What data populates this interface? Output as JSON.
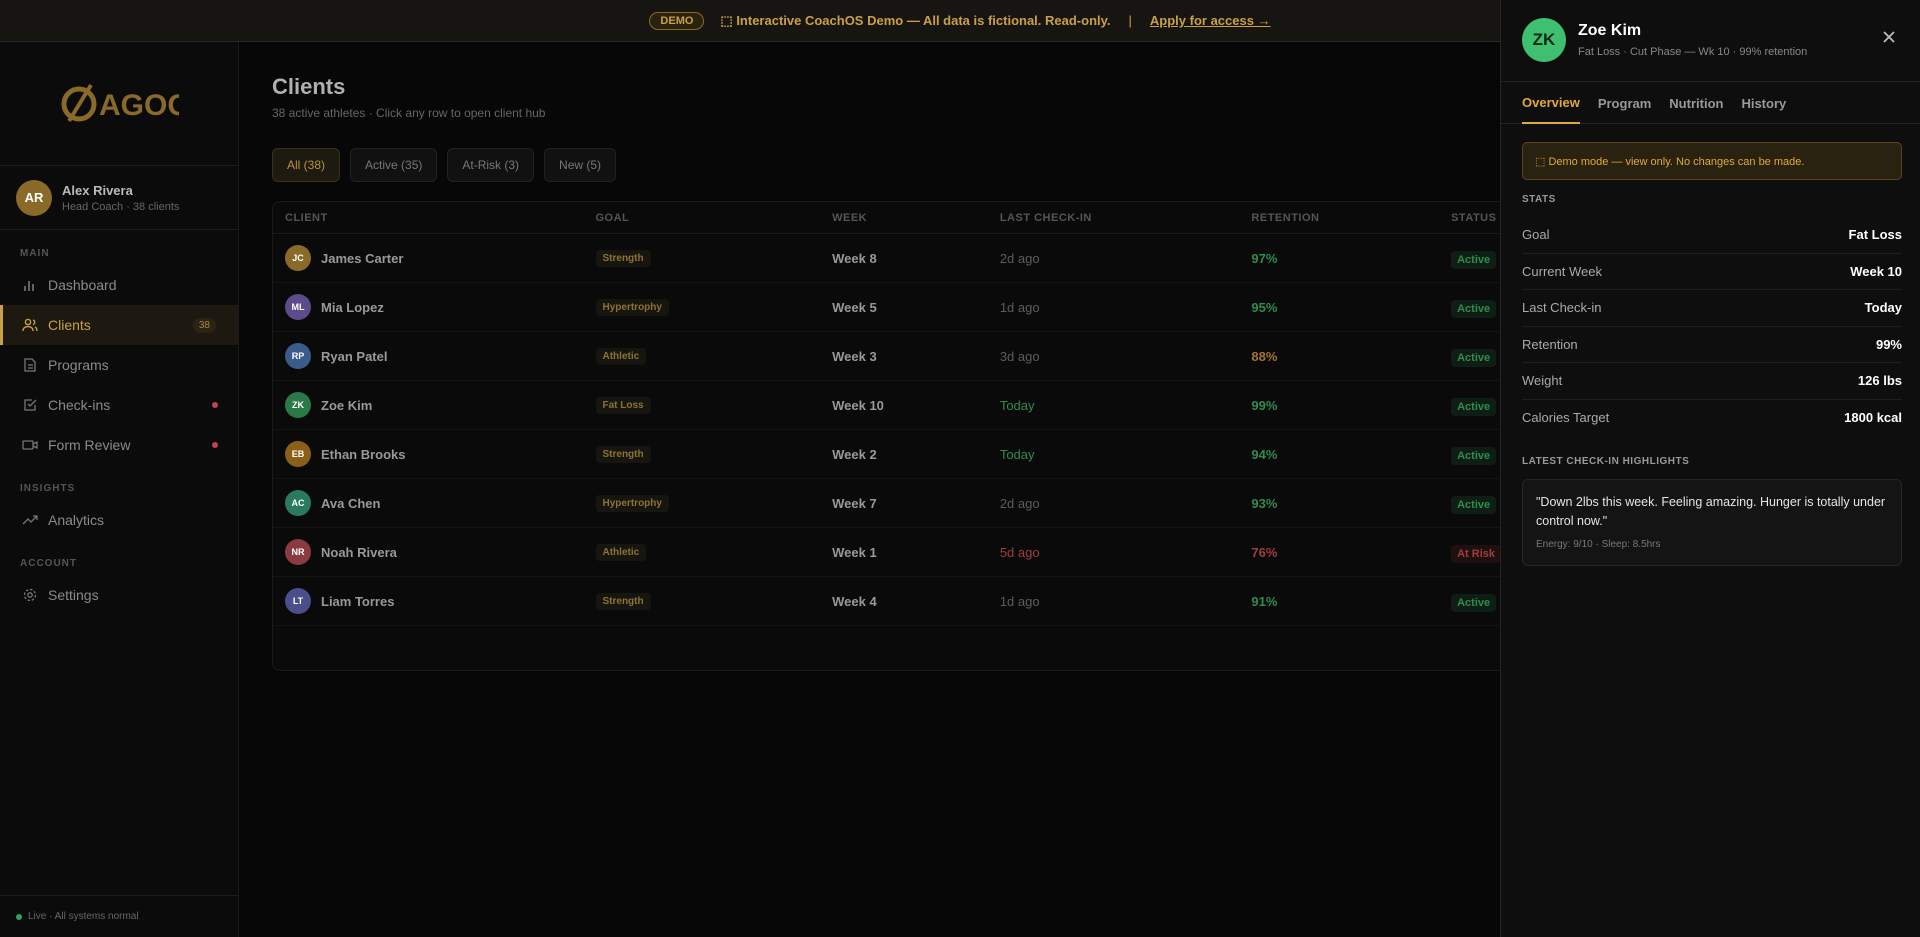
{
  "banner": {
    "badge": "DEMO",
    "message": "⬚ Interactive CoachOS Demo — All data is fictional. Read-only.",
    "separator": "|",
    "cta": "Apply for access →"
  },
  "sidebar": {
    "logo_text": "AGOGE",
    "coach": {
      "initials": "AR",
      "name": "Alex Rivera",
      "role": "Head Coach · 38 clients"
    },
    "sections": {
      "main": "MAIN",
      "insights": "INSIGHTS",
      "account": "ACCOUNT"
    },
    "items": [
      {
        "label": "Dashboard",
        "icon": "bar-chart-icon"
      },
      {
        "label": "Clients",
        "icon": "users-icon",
        "count": "38",
        "active": true
      },
      {
        "label": "Programs",
        "icon": "document-icon"
      },
      {
        "label": "Check-ins",
        "icon": "checkbox-icon",
        "alert": true
      },
      {
        "label": "Form Review",
        "icon": "video-icon",
        "alert": true
      },
      {
        "label": "Analytics",
        "icon": "trend-icon"
      },
      {
        "label": "Settings",
        "icon": "gear-icon"
      }
    ],
    "status": "Live · All systems normal"
  },
  "main": {
    "title": "Clients",
    "subtitle": "38 active athletes · Click any row to open client hub",
    "filters": [
      "All (38)",
      "Active (35)",
      "At-Risk (3)",
      "New (5)"
    ],
    "columns": [
      "CLIENT",
      "GOAL",
      "WEEK",
      "LAST CHECK-IN",
      "RETENTION",
      "STATUS"
    ],
    "rows": [
      {
        "initials": "JC",
        "name": "James Carter",
        "goal": "Strength",
        "week": "Week 8",
        "checkin": "2d ago",
        "retention": "97%",
        "status": "Active"
      },
      {
        "initials": "ML",
        "name": "Mia Lopez",
        "goal": "Hypertrophy",
        "week": "Week 5",
        "checkin": "1d ago",
        "retention": "95%",
        "status": "Active"
      },
      {
        "initials": "RP",
        "name": "Ryan Patel",
        "goal": "Athletic",
        "week": "Week 3",
        "checkin": "3d ago",
        "retention": "88%",
        "status": "Active"
      },
      {
        "initials": "ZK",
        "name": "Zoe Kim",
        "goal": "Fat Loss",
        "week": "Week 10",
        "checkin": "Today",
        "retention": "99%",
        "status": "Active"
      },
      {
        "initials": "EB",
        "name": "Ethan Brooks",
        "goal": "Strength",
        "week": "Week 2",
        "checkin": "Today",
        "retention": "94%",
        "status": "Active"
      },
      {
        "initials": "AC",
        "name": "Ava Chen",
        "goal": "Hypertrophy",
        "week": "Week 7",
        "checkin": "2d ago",
        "retention": "93%",
        "status": "Active"
      },
      {
        "initials": "NR",
        "name": "Noah Rivera",
        "goal": "Athletic",
        "week": "Week 1",
        "checkin": "5d ago",
        "retention": "76%",
        "status": "At Risk"
      },
      {
        "initials": "LT",
        "name": "Liam Torres",
        "goal": "Strength",
        "week": "Week 4",
        "checkin": "1d ago",
        "retention": "91%",
        "status": "Active"
      }
    ]
  },
  "panel": {
    "initials": "ZK",
    "name": "Zoe Kim",
    "subtitle": "Fat Loss · Cut Phase — Wk 10 · 99% retention",
    "tabs": [
      "Overview",
      "Program",
      "Nutrition",
      "History"
    ],
    "notice": "⬚ Demo mode — view only. No changes can be made.",
    "stats_header": "STATS",
    "stats": [
      {
        "label": "Goal",
        "value": "Fat Loss"
      },
      {
        "label": "Current Week",
        "value": "Week 10"
      },
      {
        "label": "Last Check-in",
        "value": "Today"
      },
      {
        "label": "Retention",
        "value": "99%"
      },
      {
        "label": "Weight",
        "value": "126 lbs"
      },
      {
        "label": "Calories Target",
        "value": "1800 kcal"
      }
    ],
    "highlights_header": "LATEST CHECK-IN HIGHLIGHTS",
    "highlight_quote": "\"Down 2lbs this week. Feeling amazing. Hunger is totally under control now.\"",
    "highlight_meta": "Energy: 9/10 · Sleep: 8.5hrs"
  },
  "colors": {
    "accent": "#e0a93a",
    "success": "#2e8c4d",
    "danger": "#a03c3c"
  }
}
